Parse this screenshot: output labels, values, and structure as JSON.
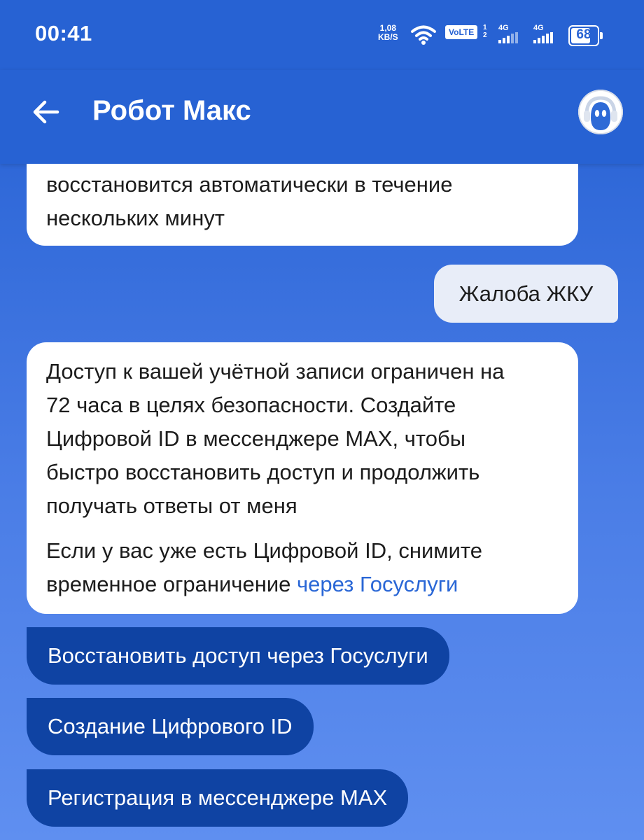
{
  "status_bar": {
    "time": "00:41",
    "speed_value": "1,08",
    "speed_unit": "KB/S",
    "volte": "VoLTE",
    "sim1_label": "4G",
    "sim2_label": "4G",
    "sim_numbers": [
      "1",
      "2"
    ],
    "battery_percent": "68",
    "icons": [
      "wifi-icon",
      "signal-icon",
      "battery-icon"
    ]
  },
  "header": {
    "back_icon": "arrow-left-icon",
    "title": "Робот Макс",
    "avatar_icon": "robot-avatar-icon"
  },
  "chat": {
    "messages": [
      {
        "from": "bot",
        "lines": [
          "восстановится автоматически в течение",
          "нескольких минут"
        ]
      },
      {
        "from": "user",
        "text": "Жалоба ЖКУ"
      },
      {
        "from": "bot",
        "paragraph1": [
          "Доступ к вашей учётной записи ограничен на",
          "72 часа в целях безопасности. Создайте",
          "Цифровой ID в мессенджере MAX, чтобы",
          "быстро восстановить доступ и продолжить",
          "получать ответы от меня"
        ],
        "paragraph2_line1": "Если у вас уже есть Цифровой ID, снимите",
        "paragraph2_line2_text": "временное ограничение ",
        "paragraph2_link": "через Госуслуги"
      }
    ],
    "quick_replies": [
      "Восстановить доступ через Госуслуги",
      "Создание Цифрового ID",
      "Регистрация в мессенджере MAX"
    ]
  },
  "colors": {
    "header_blue": "#2762d3",
    "chip_blue": "#0f43a3",
    "link_blue": "#2a67d6",
    "user_bubble": "#e8edf8"
  }
}
